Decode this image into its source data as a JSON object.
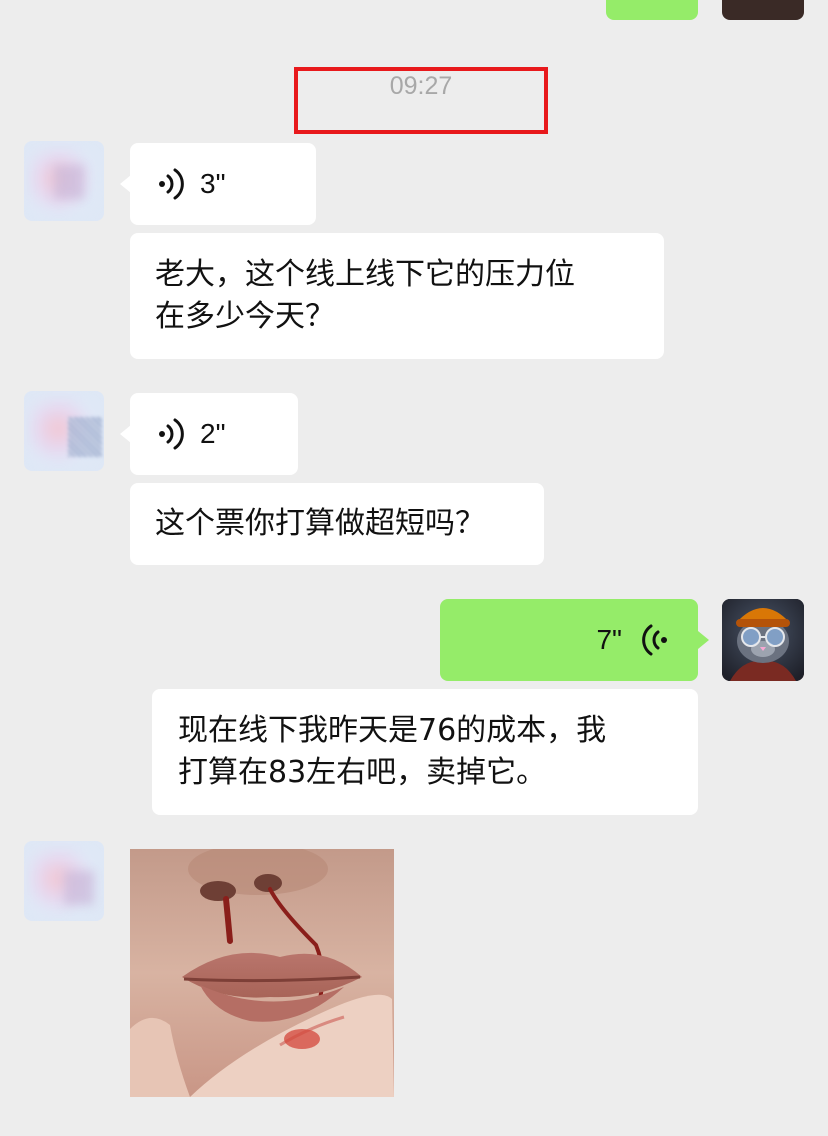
{
  "timestamp": "09:27",
  "messages": [
    {
      "id": "m1",
      "side": "left",
      "type": "voice",
      "duration": "3\""
    },
    {
      "id": "m2",
      "side": "left",
      "type": "text",
      "lines": [
        "老大，这个线上线下它的压力位",
        "在多少今天？"
      ]
    },
    {
      "id": "m3",
      "side": "left",
      "type": "voice",
      "duration": "2\""
    },
    {
      "id": "m4",
      "side": "left",
      "type": "text",
      "lines": [
        "这个票你打算做超短吗？"
      ]
    },
    {
      "id": "m5",
      "side": "right",
      "type": "voice",
      "duration": "7\""
    },
    {
      "id": "m6",
      "side": "right",
      "type": "text",
      "lines": [
        "现在线下我昨天是76的成本，我",
        "打算在83左右吧，卖掉它。"
      ]
    },
    {
      "id": "m7",
      "side": "left",
      "type": "image"
    }
  ],
  "colors": {
    "background": "#ededed",
    "bubble_received": "#ffffff",
    "bubble_sent": "#95ec69",
    "highlight_box": "#e8191c",
    "timestamp_text": "#a8a8a8"
  },
  "icons": {
    "voice_received": "voice-wave-icon",
    "voice_sent": "voice-wave-icon"
  }
}
